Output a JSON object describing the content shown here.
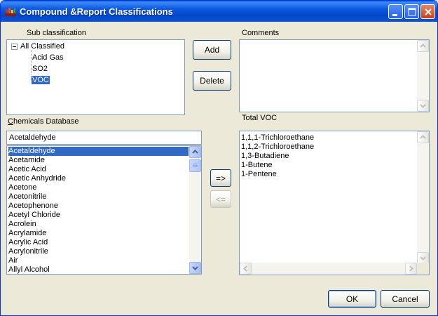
{
  "window": {
    "title": "Compound &Report Classifications"
  },
  "sub_classification": {
    "label": "Sub classification",
    "tree": {
      "root": "All Classified",
      "children": [
        "Acid Gas",
        "SO2",
        "VOC"
      ],
      "selected": "VOC"
    }
  },
  "buttons": {
    "add": "Add",
    "delete": "Delete",
    "move_right": "=>",
    "move_left": "<=",
    "ok": "OK",
    "cancel": "Cancel"
  },
  "comments": {
    "label": "Comments"
  },
  "chemicals_database": {
    "label_first": "C",
    "label_rest": "hemicals Database",
    "search_value": "Acetaldehyde",
    "items": [
      "Acetaldehyde",
      "Acetamide",
      "Acetic Acid",
      "Acetic Anhydride",
      "Acetone",
      "Acetonitrile",
      "Acetophenone",
      "Acetyl Chloride",
      "Acrolein",
      "Acrylamide",
      "Acrylic Acid",
      "Acrylonitrile",
      "Air",
      "Allyl Alcohol"
    ],
    "selected": "Acetaldehyde"
  },
  "total_voc": {
    "label": "Total VOC",
    "items": [
      "1,1,1-Trichloroethane",
      "1,1,2-Trichloroethane",
      "1,3-Butadiene",
      "1-Butene",
      "1-Pentene"
    ]
  },
  "colors": {
    "titlebar": "#0a58e0",
    "selection": "#316ac5",
    "dialog_bg": "#ece9d8"
  }
}
